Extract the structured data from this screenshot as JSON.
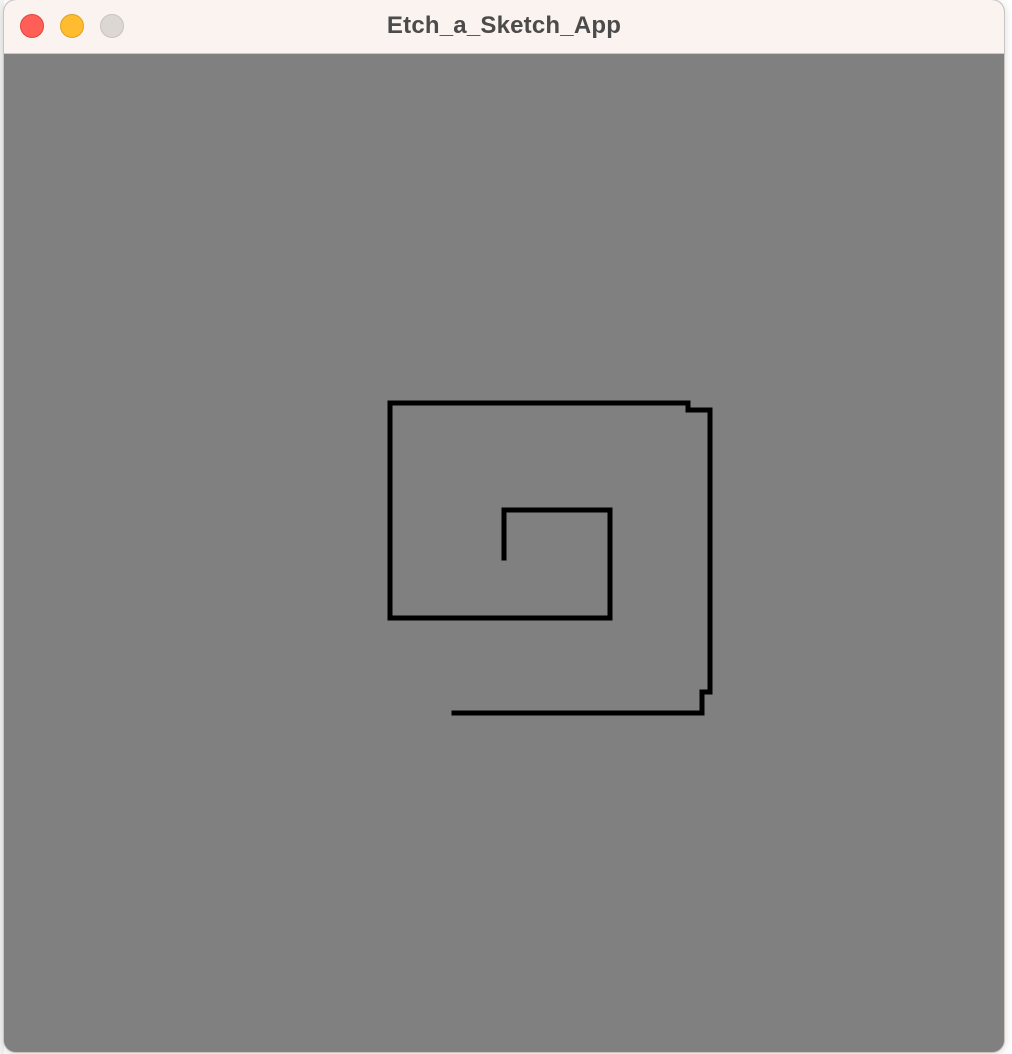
{
  "window": {
    "title": "Etch_a_Sketch_App"
  },
  "traffic_lights": {
    "close_color": "#ff5f57",
    "minimize_color": "#febc2e",
    "zoom_color": "#dcd7d3"
  },
  "canvas": {
    "background_color": "#808080",
    "stroke_color": "#000000"
  }
}
